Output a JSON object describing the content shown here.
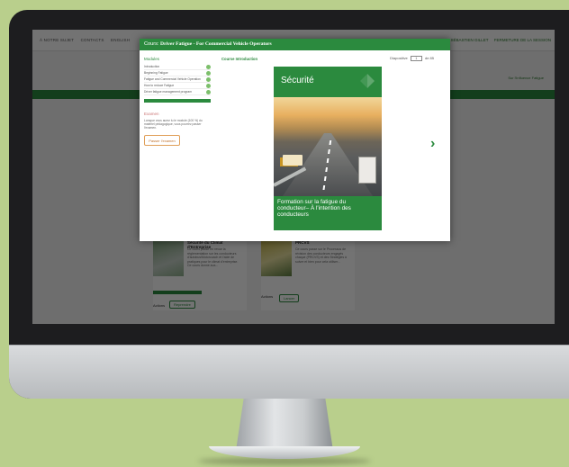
{
  "site": {
    "nav": [
      "À NOTRE SUJET",
      "CONTACTS",
      "ENGLISH"
    ],
    "user": [
      "SÉBASTIEN GILLET",
      "FERMETURE DE LA SESSION"
    ],
    "link": "Sur l'Influence Fatigue"
  },
  "cards": [
    {
      "title": "Sécurité du Climat d'Entreprise",
      "desc": "Ce cours passe en revue la règlementation sur les conducteurs d'autobus/Motorcoach et l'aide de pratiques pour le climat d'entreprise. Ce cours donne aux...",
      "action_label": "Actions",
      "action": "Reprendre"
    },
    {
      "title": "PRCVS",
      "desc": "Ce cours passe sur le Processus de révision des conducteurs engagés chaque (PRCVS) et des Stratégies à suivre et bien pour cela utiliser...",
      "action_label": "Actions",
      "action": "Lancer"
    }
  ],
  "modal": {
    "prefix": "Cours:",
    "title": "Driver Fatigue - For Commercial Vehicle Operators",
    "modules_heading": "Modules",
    "modules": [
      "Introduction",
      "Beginning Fatigue",
      "Fatigue and Commercial Vehicle Operation",
      "How to reduce Fatigue",
      "Driver fatigue management program"
    ],
    "exam_heading": "Examen",
    "exam_text": "Lorsque vous aurez lu le module (100 %) du matériel pédagogique, vous pourrez passer l'examen.",
    "exam_button": "Passer l'examen",
    "content_title": "Course Introduction",
    "pager": {
      "label": "Diapositive",
      "current": "1",
      "of": "de",
      "total": "85"
    },
    "slide": {
      "title": "Sécurité",
      "caption": "Formation sur la fatigue du conducteur– À l'intention des conducteurs"
    }
  },
  "colors": {
    "brand_green": "#2b8a3e",
    "background": "#b9cf8c"
  }
}
